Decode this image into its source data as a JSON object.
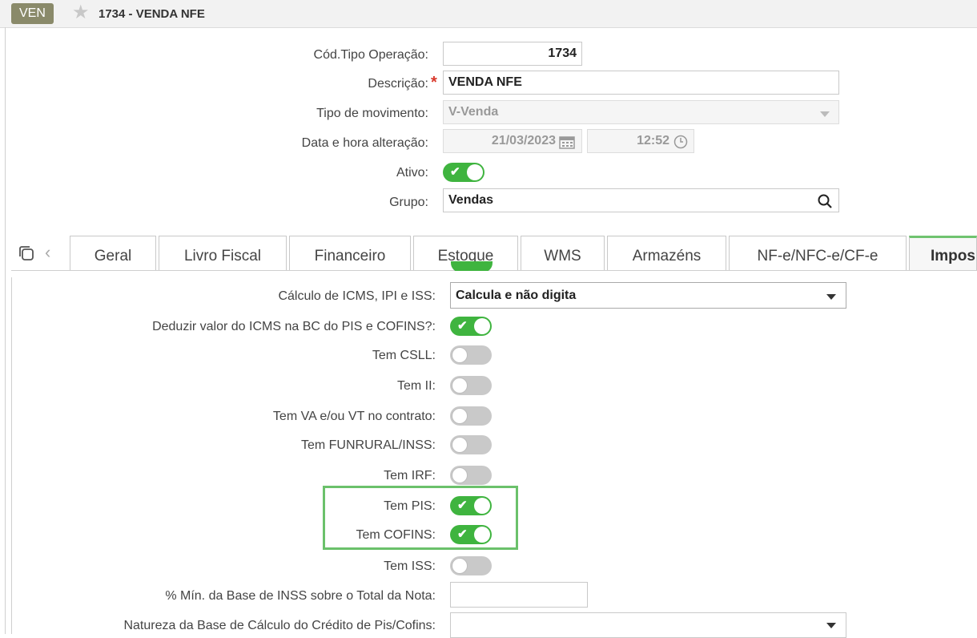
{
  "window": {
    "badge": "VEN",
    "title": "1734 - VENDA NFE"
  },
  "header_form": {
    "cod_label": "Cód.Tipo Operação:",
    "cod_value": "1734",
    "descricao_label": "Descrição:",
    "descricao_required": "*",
    "descricao_value": "VENDA NFE",
    "tipo_label": "Tipo de movimento:",
    "tipo_value": "V-Venda",
    "data_label": "Data e hora alteração:",
    "data_value": "21/03/2023",
    "hora_value": "12:52",
    "ativo_label": "Ativo:",
    "grupo_label": "Grupo:",
    "grupo_value": "Vendas"
  },
  "tabs": [
    {
      "label": "Geral"
    },
    {
      "label": "Livro Fiscal"
    },
    {
      "label": "Financeiro"
    },
    {
      "label": "Estoque"
    },
    {
      "label": "WMS"
    },
    {
      "label": "Armazéns"
    },
    {
      "label": "NF-e/NFC-e/CF-e"
    },
    {
      "label": "Impos"
    }
  ],
  "impostos": {
    "calculo_label": "Cálculo de ICMS, IPI e ISS:",
    "calculo_value": "Calcula e não digita",
    "rows": [
      {
        "label": "Deduzir valor do ICMS na BC do PIS e COFINS?:",
        "on": true
      },
      {
        "label": "Tem CSLL:",
        "on": false
      },
      {
        "label": "Tem II:",
        "on": false
      },
      {
        "label": "Tem VA e/ou VT no contrato:",
        "on": false
      },
      {
        "label": "Tem FUNRURAL/INSS:",
        "on": false
      },
      {
        "label": "Tem IRF:",
        "on": false
      },
      {
        "label": "Tem PIS:",
        "on": true
      },
      {
        "label": "Tem COFINS:",
        "on": true
      },
      {
        "label": "Tem ISS:",
        "on": false
      }
    ],
    "min_base_label": "% Mín. da Base de INSS sobre o Total da Nota:",
    "min_base_value": "",
    "natureza_label": "Natureza da Base de Cálculo do Crédito de Pis/Cofins:",
    "natureza_value": ""
  },
  "colors": {
    "toggle_on": "#3fb43f",
    "toggle_off": "#c9c9c9",
    "highlight": "#6bc16b",
    "required": "#d9382b"
  }
}
